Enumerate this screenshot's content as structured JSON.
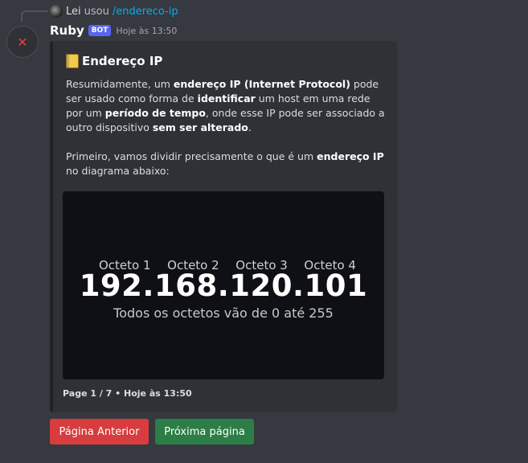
{
  "reply": {
    "username": "Lei",
    "verb": "usou",
    "command": "/endereco-ip"
  },
  "message": {
    "author": "Ruby",
    "badge": "BOT",
    "timestamp": "Hoje às 13:50"
  },
  "embed": {
    "title": "Endereço IP",
    "title_icon": "notebook-icon",
    "desc1": [
      {
        "t": "Resumidamente, um ",
        "b": false
      },
      {
        "t": "endereço IP (Internet Protocol)",
        "b": true
      },
      {
        "t": " pode ser usado como forma de ",
        "b": false
      },
      {
        "t": "identificar",
        "b": true
      },
      {
        "t": " um host em uma rede por um ",
        "b": false
      },
      {
        "t": "período de tempo",
        "b": true
      },
      {
        "t": ", onde esse IP pode ser associado a outro dispositivo ",
        "b": false
      },
      {
        "t": "sem ser alterado",
        "b": true
      },
      {
        "t": ".",
        "b": false
      }
    ],
    "desc2": [
      {
        "t": "Primeiro, vamos dividir precisamente o que é um ",
        "b": false
      },
      {
        "t": "endereço IP",
        "b": true
      },
      {
        "t": " no diagrama abaixo:",
        "b": false
      }
    ],
    "diagram": {
      "octet_labels": [
        "Octeto 1",
        "Octeto 2",
        "Octeto 3",
        "Octeto 4"
      ],
      "ip": "192.168.120.101",
      "note": "Todos os octetos vão de 0 até 255"
    },
    "footer": "Page 1 / 7 • Hoje às 13:50"
  },
  "buttons": {
    "prev": "Página Anterior",
    "next": "Próxima página"
  },
  "colors": {
    "background": "#36393f",
    "embed_bg": "#2f3136",
    "bot_badge": "#5865f2",
    "command_link": "#00aff4",
    "button_danger": "#d83c3e",
    "button_success": "#2d7d46"
  }
}
